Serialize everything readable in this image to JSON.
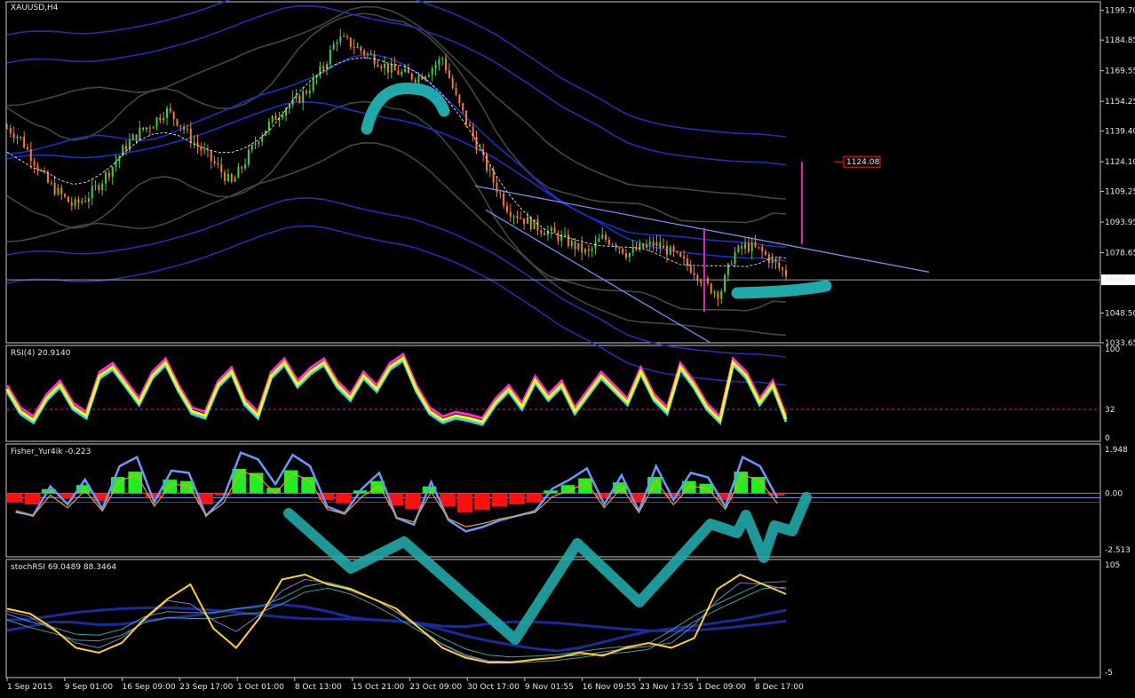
{
  "symbol_label": "XAUUSD,H4",
  "colors": {
    "background": "#000000",
    "frame": "#c8c8c8",
    "text": "#e6e6e6",
    "bull_candle": "#3fd13f",
    "bear_candle": "#ff7a1a",
    "channel_line": "#6f8ff0",
    "envelope_blue": "#1f2fb0",
    "envelope_gray": "#3c4a44",
    "marker_cyan": "#1fa9a9",
    "magenta": "#e020c0",
    "price_tag": "#ff2020",
    "rsi_yellow": "#ffff00",
    "rsi_magenta": "#ff2bd6",
    "rsi_cyan": "#22ddff",
    "fisher_green": "#22ee22",
    "fisher_red": "#ff1010",
    "fisher_blue": "#6699ff",
    "fisher_orange": "#f0a020",
    "stoch_yellow": "#ffd21a",
    "stoch_teal": "#3aa0a0"
  },
  "time_axis": [
    "1 Sep 2015",
    "9 Sep 01:00",
    "16 Sep 09:00",
    "23 Sep 17:00",
    "1 Oct 01:00",
    "8 Oct 13:00",
    "15 Oct 21:00",
    "23 Oct 09:00",
    "30 Oct 17:00",
    "9 Nov 01:55",
    "16 Nov 09:55",
    "23 Nov 17:55",
    "1 Dec 09:00",
    "8 Dec 17:00"
  ],
  "chart_data": [
    {
      "type": "candlestick",
      "title": "XAUUSD,H4",
      "ylim": [
        1033.65,
        1204.0
      ],
      "y_ticks": [
        "1199.70",
        "1184.85",
        "1169.55",
        "1154.25",
        "1139.40",
        "1124.10",
        "1109.25",
        "1093.95",
        "1078.65",
        "1048.50",
        "1033.65"
      ],
      "current_price": "1065.10",
      "price_tag": "1124.08",
      "close_path": [
        1141,
        1136,
        1125,
        1114,
        1108,
        1102,
        1106,
        1113,
        1122,
        1132,
        1139,
        1143,
        1150,
        1144,
        1135,
        1128,
        1121,
        1113,
        1124,
        1136,
        1144,
        1151,
        1155,
        1162,
        1172,
        1186,
        1183,
        1179,
        1175,
        1170,
        1168,
        1166,
        1170,
        1176,
        1156,
        1141,
        1126,
        1112,
        1100,
        1096,
        1092,
        1089,
        1086,
        1082,
        1078,
        1086,
        1084,
        1078,
        1081,
        1083,
        1080,
        1075,
        1070,
        1062,
        1058,
        1078,
        1082,
        1080,
        1074,
        1068
      ]
    },
    {
      "type": "line",
      "title": "RSI(4) 20.9140",
      "ylim": [
        0,
        100
      ],
      "y_ticks": [
        "100",
        "32",
        "0"
      ],
      "level": 32,
      "values": [
        55,
        30,
        20,
        45,
        60,
        35,
        25,
        70,
        80,
        60,
        40,
        70,
        85,
        55,
        30,
        25,
        60,
        75,
        40,
        25,
        70,
        85,
        60,
        75,
        85,
        60,
        45,
        70,
        55,
        80,
        90,
        55,
        30,
        20,
        25,
        22,
        18,
        40,
        55,
        35,
        65,
        45,
        60,
        30,
        50,
        70,
        55,
        40,
        75,
        45,
        30,
        80,
        60,
        35,
        20,
        85,
        70,
        40,
        60,
        21
      ]
    },
    {
      "type": "bar",
      "title": "Fisher_Yur4ik -0.223",
      "y_ticks": [
        "1.948",
        "0.00",
        "-2.513"
      ],
      "ylim": [
        -2.513,
        1.948
      ],
      "values": [
        -0.8,
        -1.0,
        0.3,
        -0.5,
        0.6,
        -0.7,
        1.2,
        1.6,
        -0.4,
        1.0,
        0.9,
        -1.0,
        -0.2,
        1.8,
        1.5,
        0.4,
        1.7,
        1.2,
        -0.6,
        -0.9,
        0.2,
        0.9,
        -1.1,
        -1.4,
        0.5,
        -1.2,
        -1.7,
        -1.5,
        -1.2,
        -1.0,
        -0.8,
        0.2,
        0.6,
        1.1,
        -0.5,
        0.8,
        -0.8,
        1.2,
        -0.3,
        0.9,
        0.7,
        -0.6,
        1.6,
        1.2,
        -0.223
      ]
    },
    {
      "type": "line",
      "title": "stochRSI 69.0489 88.3464",
      "ylim": [
        -5,
        105
      ],
      "y_ticks": [
        "105",
        "-5"
      ],
      "values": [
        60,
        55,
        40,
        20,
        15,
        25,
        50,
        70,
        85,
        40,
        20,
        50,
        90,
        95,
        85,
        80,
        70,
        60,
        40,
        20,
        10,
        5,
        5,
        8,
        10,
        15,
        12,
        20,
        25,
        20,
        30,
        80,
        95,
        85,
        75
      ]
    }
  ]
}
